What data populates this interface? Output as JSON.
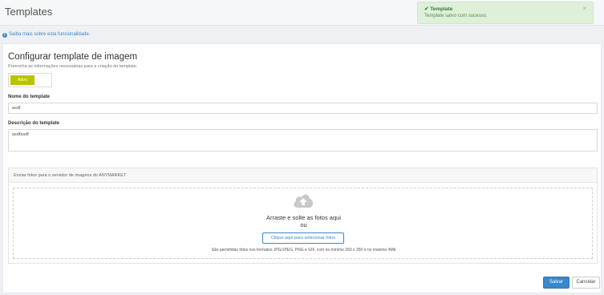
{
  "header": {
    "title": "Templates"
  },
  "toast": {
    "title": "✔ Template",
    "message": "Template salvo com sucesso.",
    "close": "×",
    "color": "#dff0d8"
  },
  "info_link": {
    "icon": "info-icon",
    "text": "Saiba mais sobre esta funcionalidade."
  },
  "config": {
    "title": "Configurar template de imagem",
    "subtitle": "Preencha as informações necessárias para a criação do template.",
    "status_toggle": {
      "label": "Ativo",
      "active": true,
      "color": "#b8c400"
    }
  },
  "form": {
    "name_label": "Nome do template",
    "name_value": "asdf",
    "description_label": "Descrição do template",
    "description_value": "asdfasdf"
  },
  "upload": {
    "header": "Enviar fotos para o servidor de imagens do ANYMARKET",
    "cloud_icon": "cloud-upload-icon",
    "drag_text": "Arraste e solte as fotos aqui",
    "or_text": "ou",
    "pick_button": "Clique aqui para selecionar fotos",
    "formats_note": "São permitidas fotos nos formatos JPG/JPEG, PNG e GIF, com no mínimo 350 x 350 e no máximo 4Mb"
  },
  "actions": {
    "save": "Salvar",
    "cancel": "Cancelar",
    "primary_color": "#3a87c9"
  }
}
